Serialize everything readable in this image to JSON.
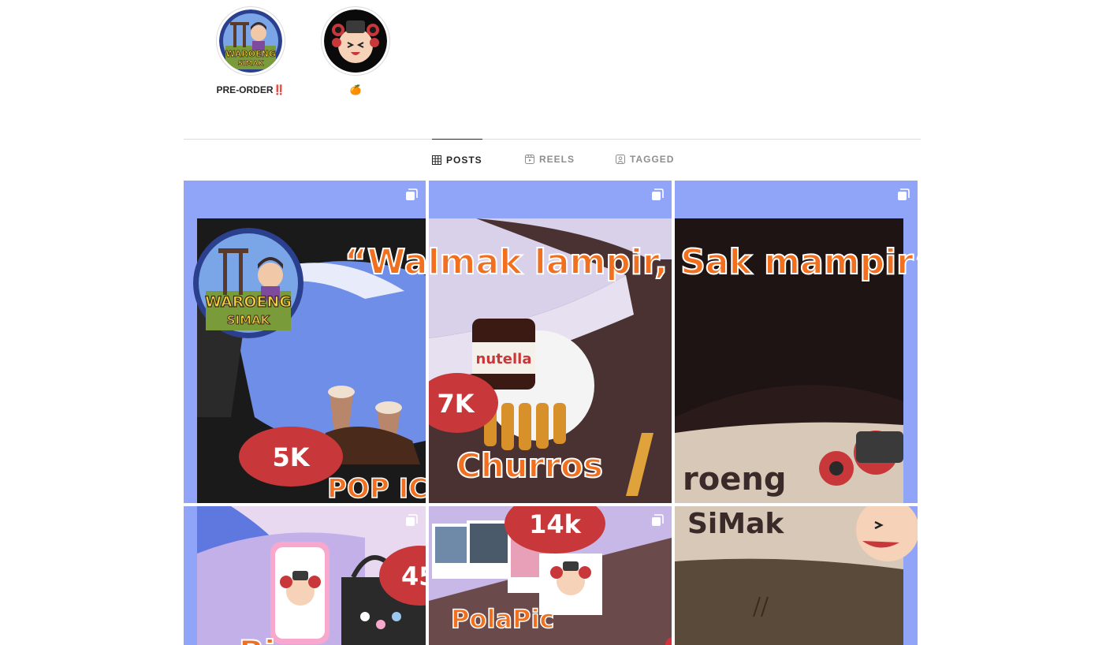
{
  "highlights": [
    {
      "label": "PRE-ORDER‼️",
      "icon": "waroeng-simak-logo",
      "logo_line1": "WAROENG",
      "logo_line2": "SIMAK"
    },
    {
      "label": "🍊",
      "icon": "mascot-face"
    }
  ],
  "tabs": [
    {
      "label": "POSTS",
      "icon": "grid-icon",
      "active": true
    },
    {
      "label": "REELS",
      "icon": "reels-icon",
      "active": false
    },
    {
      "label": "TAGGED",
      "icon": "tagged-icon",
      "active": false
    }
  ],
  "posts": {
    "banner_text": "“Walmak lampir, Sak mampir”",
    "p1": {
      "badge": "5K",
      "title": "POP IC",
      "logo_line1": "WAROENG",
      "logo_line2": "SIMAK"
    },
    "p2": {
      "badge": "7K",
      "title": "Churros",
      "jar_label": "nutella"
    },
    "p3": {
      "sign_line1": "roeng",
      "sign_line2": "SiMak"
    },
    "p4": {
      "badge": "45",
      "title": "Bi"
    },
    "p5": {
      "badge": "14k",
      "title": "PolaPic"
    },
    "p6": {}
  },
  "colors": {
    "tile_bg": "#90a4f8",
    "badge_red": "#c8373a",
    "orange_text": "#f07020",
    "tab_active": "#262626",
    "tab_inactive": "#8e8e8e"
  }
}
